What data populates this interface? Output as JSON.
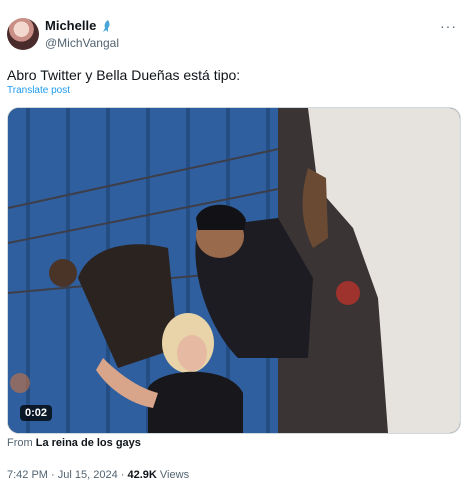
{
  "author": {
    "display_name": "Michelle",
    "handle": "@MichVangal",
    "badge_icon": "mermaid-emoji-icon"
  },
  "tweet": {
    "text": "Abro Twitter y Bella Dueñas está tipo:",
    "translate_label": "Translate post"
  },
  "media": {
    "duration": "0:02"
  },
  "source": {
    "prefix": "From",
    "name": "La reina de los gays"
  },
  "meta": {
    "time": "7:42 PM",
    "separator": "·",
    "date": "Jul 15, 2024",
    "views_count": "42.9K",
    "views_label": "Views"
  },
  "colors": {
    "link": "#1d9bf0",
    "secondary_text": "#536471"
  }
}
